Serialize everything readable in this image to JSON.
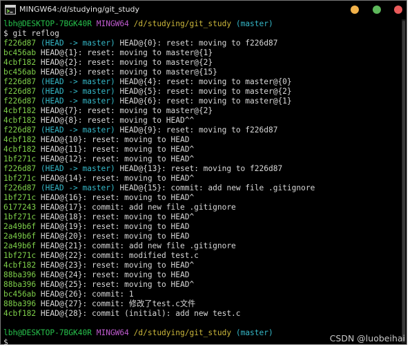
{
  "window": {
    "title": "MINGW64:/d/studying/git_study",
    "colors": {
      "bg": "#000000",
      "text": "#cfcfcf",
      "hash": "#7fd14a",
      "user": "#27c24c",
      "mingw": "#c05bd0",
      "path": "#cbb73b",
      "branch": "#35b8c8"
    }
  },
  "prompt": {
    "user": "lbh@DESKTOP-7BGK40R",
    "env": "MINGW64",
    "path": "/d/studying/git_study",
    "branch": "(master)",
    "command": "$ git reflog"
  },
  "reflog": [
    {
      "hash": "f226d87",
      "ref": "(HEAD -> master)",
      "entry": "HEAD@{0}: reset: moving to f226d87"
    },
    {
      "hash": "bc456ab",
      "ref": "",
      "entry": "HEAD@{1}: reset: moving to master@{1}"
    },
    {
      "hash": "4cbf182",
      "ref": "",
      "entry": "HEAD@{2}: reset: moving to master@{2}"
    },
    {
      "hash": "bc456ab",
      "ref": "",
      "entry": "HEAD@{3}: reset: moving to master@{15}"
    },
    {
      "hash": "f226d87",
      "ref": "(HEAD -> master)",
      "entry": "HEAD@{4}: reset: moving to master@{0}"
    },
    {
      "hash": "f226d87",
      "ref": "(HEAD -> master)",
      "entry": "HEAD@{5}: reset: moving to master@{2}"
    },
    {
      "hash": "f226d87",
      "ref": "(HEAD -> master)",
      "entry": "HEAD@{6}: reset: moving to master@{1}"
    },
    {
      "hash": "4cbf182",
      "ref": "",
      "entry": "HEAD@{7}: reset: moving to master@{2}"
    },
    {
      "hash": "4cbf182",
      "ref": "",
      "entry": "HEAD@{8}: reset: moving to HEAD^^"
    },
    {
      "hash": "f226d87",
      "ref": "(HEAD -> master)",
      "entry": "HEAD@{9}: reset: moving to f226d87"
    },
    {
      "hash": "4cbf182",
      "ref": "",
      "entry": "HEAD@{10}: reset: moving to HEAD"
    },
    {
      "hash": "4cbf182",
      "ref": "",
      "entry": "HEAD@{11}: reset: moving to HEAD^"
    },
    {
      "hash": "1bf271c",
      "ref": "",
      "entry": "HEAD@{12}: reset: moving to HEAD^"
    },
    {
      "hash": "f226d87",
      "ref": "(HEAD -> master)",
      "entry": "HEAD@{13}: reset: moving to f226d87"
    },
    {
      "hash": "1bf271c",
      "ref": "",
      "entry": "HEAD@{14}: reset: moving to HEAD^"
    },
    {
      "hash": "f226d87",
      "ref": "(HEAD -> master)",
      "entry": "HEAD@{15}: commit: add new file .gitignore"
    },
    {
      "hash": "1bf271c",
      "ref": "",
      "entry": "HEAD@{16}: reset: moving to HEAD^"
    },
    {
      "hash": "6177243",
      "ref": "",
      "entry": "HEAD@{17}: commit: add new file .gitignore"
    },
    {
      "hash": "1bf271c",
      "ref": "",
      "entry": "HEAD@{18}: reset: moving to HEAD^"
    },
    {
      "hash": "2a49b6f",
      "ref": "",
      "entry": "HEAD@{19}: reset: moving to HEAD"
    },
    {
      "hash": "2a49b6f",
      "ref": "",
      "entry": "HEAD@{20}: reset: moving to HEAD"
    },
    {
      "hash": "2a49b6f",
      "ref": "",
      "entry": "HEAD@{21}: commit: add new file .gitignore"
    },
    {
      "hash": "1bf271c",
      "ref": "",
      "entry": "HEAD@{22}: commit: modified test.c"
    },
    {
      "hash": "4cbf182",
      "ref": "",
      "entry": "HEAD@{23}: reset: moving to HEAD^"
    },
    {
      "hash": "88ba396",
      "ref": "",
      "entry": "HEAD@{24}: reset: moving to HEAD"
    },
    {
      "hash": "88ba396",
      "ref": "",
      "entry": "HEAD@{25}: reset: moving to HEAD^"
    },
    {
      "hash": "bc456ab",
      "ref": "",
      "entry": "HEAD@{26}: commit: 1"
    },
    {
      "hash": "88ba396",
      "ref": "",
      "entry": "HEAD@{27}: commit: 修改了test.c文件"
    },
    {
      "hash": "4cbf182",
      "ref": "",
      "entry": "HEAD@{28}: commit (initial): add new test.c"
    }
  ],
  "final_prompt": {
    "user": "lbh@DESKTOP-7BGK40R",
    "env": "MINGW64",
    "path": "/d/studying/git_study",
    "branch": "(master)",
    "dollar": "$"
  },
  "watermark": "CSDN @luobeihai",
  "icons": {
    "app": "mingw-terminal-icon",
    "minimize": "minimize-icon",
    "maximize": "maximize-icon",
    "close": "close-icon"
  }
}
